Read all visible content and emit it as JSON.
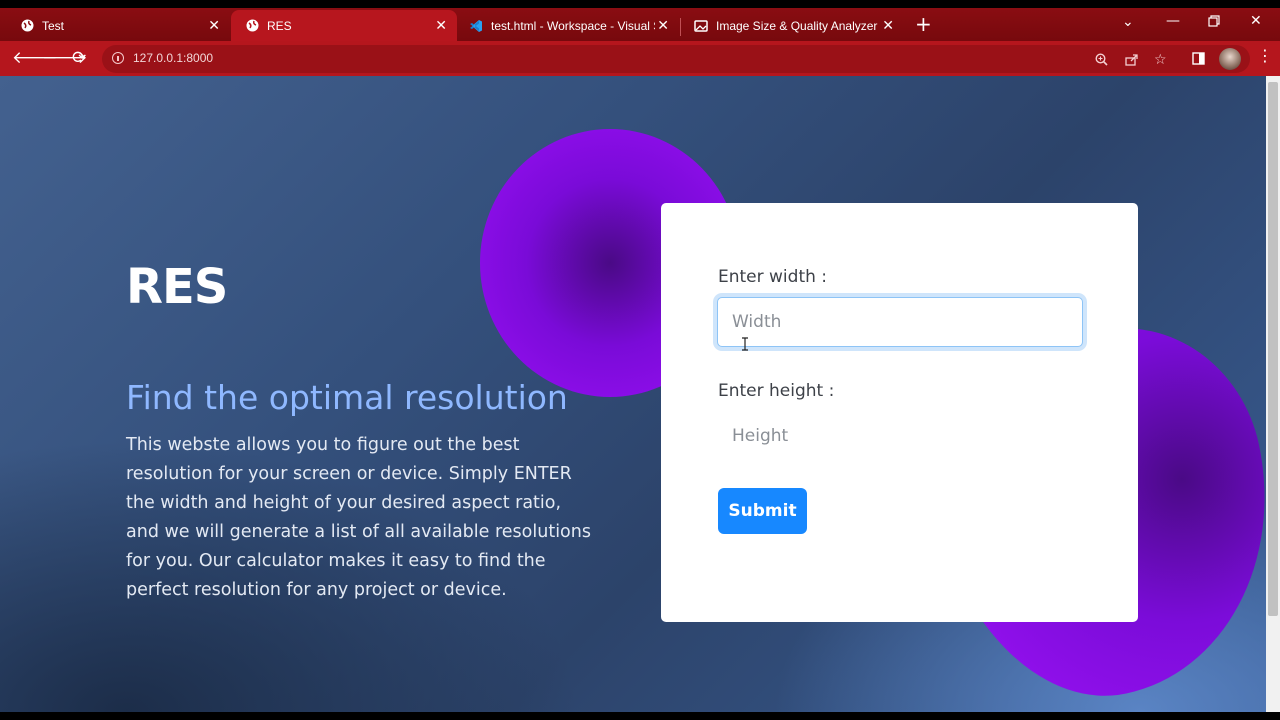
{
  "browser": {
    "tabs": [
      {
        "label": "Test",
        "active": false
      },
      {
        "label": "RES",
        "active": true
      },
      {
        "label": "test.html - Workspace - Visual St",
        "active": false
      },
      {
        "label": "Image Size & Quality Analyzer fo",
        "active": false
      }
    ],
    "url": "127.0.0.1:8000",
    "accent_color": "#b5161d"
  },
  "hero": {
    "title": "RES",
    "subtitle": "Find the optimal resolution",
    "description": "This webste allows you to figure out the best resolution for your screen or device. Simply ENTER the width and height of your desired aspect ratio, and we will generate a list of all available resolutions for you. Our calculator makes it easy to find the perfect resolution for any project or device."
  },
  "form": {
    "width_label": "Enter width :",
    "width_placeholder": "Width",
    "height_label": "Enter height :",
    "height_placeholder": "Height",
    "submit_label": "Submit",
    "button_color": "#1788ff"
  }
}
